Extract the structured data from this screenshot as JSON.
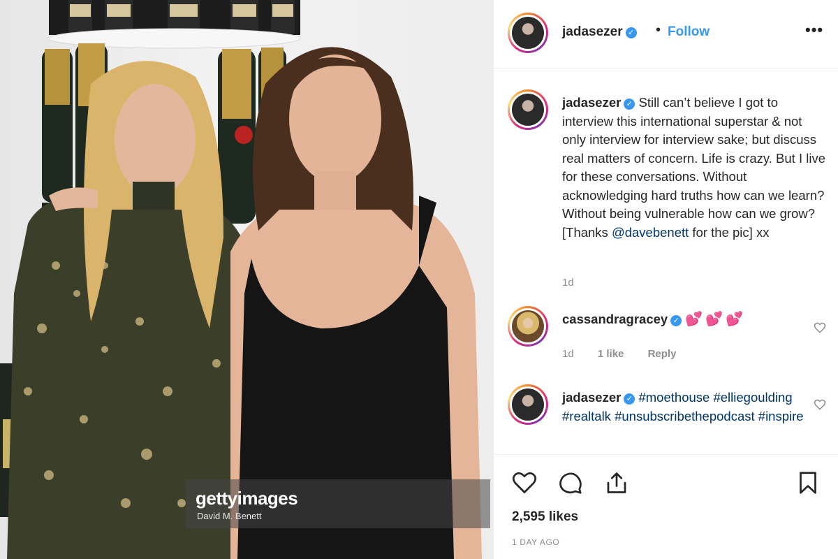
{
  "post": {
    "photo": {
      "alt_subjects": "two women posing in front of champagne bottles",
      "watermark_logo": "gettyimages",
      "watermark_credit": "David M. Benett"
    },
    "header": {
      "username": "jadasezer",
      "verified": true,
      "separator": "•",
      "follow_label": "Follow",
      "more_label": "•••"
    },
    "caption": {
      "username": "jadasezer",
      "text_before_mention": "Still can’t believe I got to interview this international superstar & not only interview for interview sake; but discuss real matters of concern. Life is crazy. But I live for these conversations. Without acknowledging hard truths how can we learn? Without being vulnerable how can we grow? [Thanks ",
      "mention": "@davebenett",
      "text_after_mention": " for the pic] xx",
      "time": "1d"
    },
    "comments": [
      {
        "username": "cassandragracey",
        "text": "💕💕💕",
        "time": "1d",
        "likes": "1 like",
        "reply_label": "Reply"
      },
      {
        "username": "jadasezer",
        "tags": [
          "#moethouse",
          "#elliegoulding",
          "#realtalk",
          "#unsubscribethepodcast",
          "#inspire"
        ]
      }
    ],
    "footer": {
      "likes_count": "2,595 likes",
      "timestamp": "1 DAY AGO"
    },
    "colors": {
      "accent": "#3897f0",
      "text": "#262626",
      "muted": "#8e8e8e",
      "mention": "#003569",
      "border": "#efefef"
    },
    "icons": [
      "verified-icon",
      "more-icon",
      "heart-icon",
      "comment-icon",
      "share-icon",
      "bookmark-icon"
    ]
  }
}
